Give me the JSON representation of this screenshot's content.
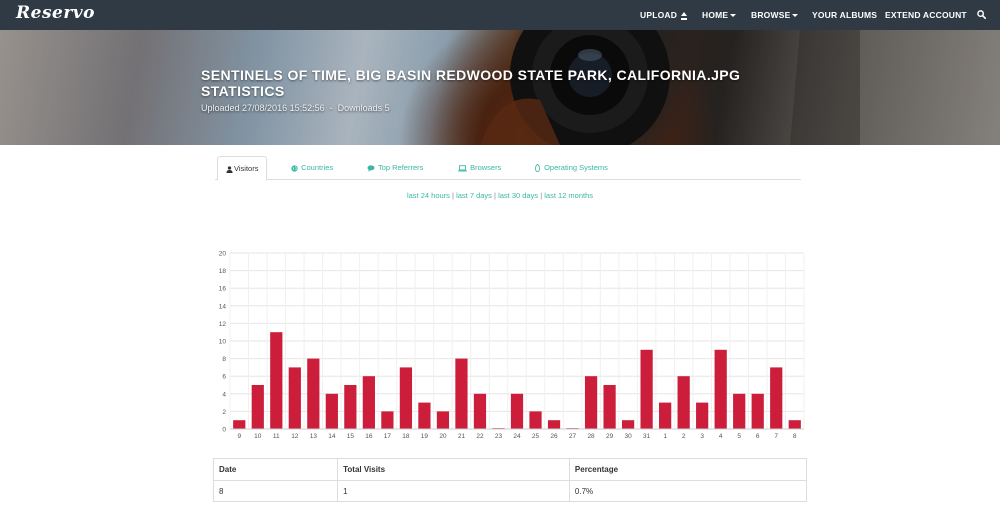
{
  "nav": {
    "logo": "Reservo",
    "upload": "UPLOAD",
    "home": "HOME",
    "browse": "BROWSE",
    "albums": "YOUR ALBUMS",
    "extend": "EXTEND ACCOUNT",
    "search_icon": "search-icon"
  },
  "hero": {
    "title": "SENTINELS OF TIME, BIG BASIN REDWOOD STATE PARK, CALIFORNIA.JPG STATISTICS",
    "uploaded": "Uploaded 27/08/2016 15:52:56",
    "separator": "-",
    "downloads": "Downloads 5"
  },
  "tabs": [
    {
      "label": "Visitors",
      "icon": "user-icon",
      "active": true
    },
    {
      "label": "Countries",
      "icon": "globe-icon",
      "active": false
    },
    {
      "label": "Top Referrers",
      "icon": "comment-icon",
      "active": false
    },
    {
      "label": "Browsers",
      "icon": "laptop-icon",
      "active": false
    },
    {
      "label": "Operating Systems",
      "icon": "leaf-icon",
      "active": false
    }
  ],
  "ranges": {
    "r24h": "last 24 hours",
    "r7d": "last 7 days",
    "r30d": "last 30 days",
    "r12m": "last 12 months",
    "sep": "|"
  },
  "chart_data": {
    "type": "bar",
    "categories": [
      "9",
      "10",
      "11",
      "12",
      "13",
      "14",
      "15",
      "16",
      "17",
      "18",
      "19",
      "20",
      "21",
      "22",
      "23",
      "24",
      "25",
      "26",
      "27",
      "28",
      "29",
      "30",
      "31",
      "1",
      "2",
      "3",
      "4",
      "5",
      "6",
      "7",
      "8"
    ],
    "values": [
      1,
      5,
      11,
      7,
      8,
      4,
      5,
      6,
      2,
      7,
      3,
      2,
      8,
      4,
      0.1,
      4,
      2,
      1,
      0.1,
      6,
      5,
      1,
      9,
      3,
      6,
      3,
      9,
      4,
      4,
      7,
      1
    ],
    "ylim": [
      0,
      20
    ],
    "yticks": [
      "0",
      "2",
      "4",
      "6",
      "8",
      "10",
      "12",
      "14",
      "16",
      "18",
      "20"
    ],
    "grid": true,
    "bar_color": "#cc1e3a"
  },
  "table": {
    "headers": [
      "Date",
      "Total Visits",
      "Percentage"
    ],
    "rows": [
      [
        "8",
        "1",
        "0.7%"
      ]
    ]
  }
}
